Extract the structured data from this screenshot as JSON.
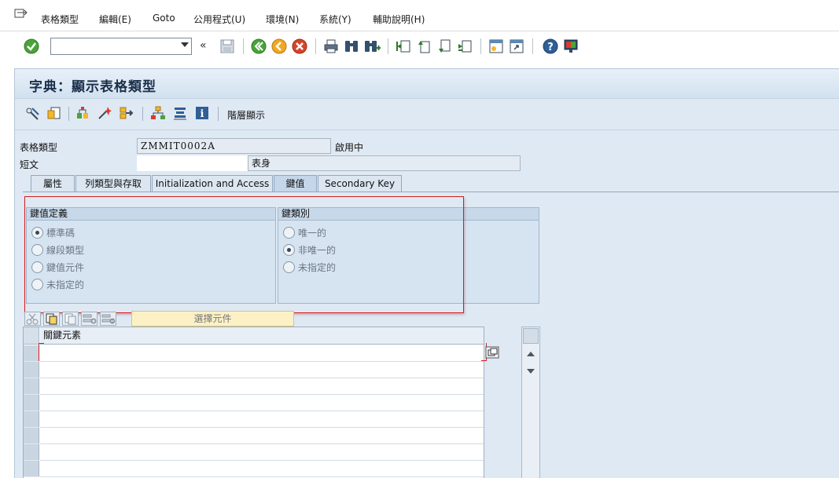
{
  "menubar": {
    "items": [
      {
        "label": "表格類型"
      },
      {
        "label": "編輯(E)"
      },
      {
        "label": "Goto"
      },
      {
        "label": "公用程式(U)"
      },
      {
        "label": "環境(N)"
      },
      {
        "label": "系統(Y)"
      },
      {
        "label": "輔助說明(H)"
      }
    ]
  },
  "toolbar": {
    "command_value": "",
    "collapse_glyph": "«"
  },
  "page": {
    "title": "字典：顯示表格類型",
    "hierarchy_label": "階層顯示"
  },
  "header": {
    "table_type_label": "表格類型",
    "table_type_value": "ZMMIT0002A",
    "status": "啟用中",
    "short_text_label": "短文",
    "short_text_value": "",
    "table_body_label": "表身"
  },
  "tabs": [
    {
      "label": "屬性"
    },
    {
      "label": "列類型與存取"
    },
    {
      "label": "Initialization and Access"
    },
    {
      "label": "鍵值"
    },
    {
      "label": "Secondary Key"
    }
  ],
  "key_definition": {
    "title": "鍵值定義",
    "options": [
      "標準碼",
      "線段類型",
      "鍵值元件",
      "未指定的"
    ],
    "selected_index": 0
  },
  "key_category": {
    "title": "鍵類別",
    "options": [
      "唯一的",
      "非唯一的",
      "未指定的"
    ],
    "selected_index": 1
  },
  "key_components": {
    "choose_button": "選擇元件",
    "column_header": "關鍵元素"
  },
  "colors": {
    "panel_bg": "#dfe9f4",
    "highlight_red": "#d51d1d",
    "choose_button_bg": "#fbf1c5"
  }
}
